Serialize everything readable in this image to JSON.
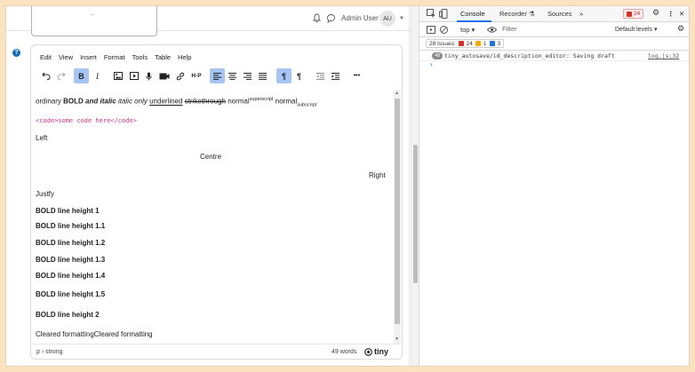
{
  "header": {
    "user_name": "Admin User",
    "avatar_initials": "AU",
    "help_glyph": "?"
  },
  "editor": {
    "menu": [
      "Edit",
      "View",
      "Insert",
      "Format",
      "Tools",
      "Table",
      "Help"
    ],
    "toolbar": {
      "bold_label": "B",
      "italic_label": "I",
      "h5p_label": "H-P",
      "ltr_label": "¶",
      "rtl_label": "¶",
      "more_label": "•••"
    },
    "content": {
      "line1": {
        "ordinary": "ordinary ",
        "bold": "BOLD",
        "bold_italic": "and italic",
        "italic": "italic only",
        "underlined": "underlined",
        "strike": "strikethrough",
        "normal1": "normal",
        "superscript": "superscript",
        "normal2": "normal",
        "subscript": "subscript"
      },
      "code": "<code>some code here</code>",
      "left": "Left",
      "centre": "Centre",
      "right": "Right",
      "justify": "Justfy",
      "bold_lines": [
        "BOLD line height 1",
        "BOLD line height 1.1",
        "BOLD line height 1.2",
        "BOLD line height 1.3",
        "BOLD line height 1.4",
        "BOLD line height 1.5",
        "BOLD line height 2"
      ],
      "cleared": "Cleared formattingCleared formatting"
    },
    "status": {
      "path": "p › strong",
      "words": "49 words",
      "brand": "tiny"
    }
  },
  "devtools": {
    "tabs": {
      "console": "Console",
      "recorder": "Recorder",
      "sources": "Sources",
      "more": "»"
    },
    "error_count": "24",
    "context": "top",
    "filter_placeholder": "Filter",
    "levels": "Default levels ▾",
    "issues": {
      "label": "28 Issues:",
      "errors": "24",
      "warnings": "1",
      "info": "3"
    },
    "log": {
      "count": "48",
      "message": "tiny_autosave/id_description_editor: Saving draft",
      "source": "log.js:32"
    },
    "prompt": "›",
    "colors": {
      "accent": "#1a73e8",
      "error": "#d93025",
      "warning": "#f9ab00",
      "editor_active": "#a6c5f4",
      "code": "#d63384"
    }
  }
}
